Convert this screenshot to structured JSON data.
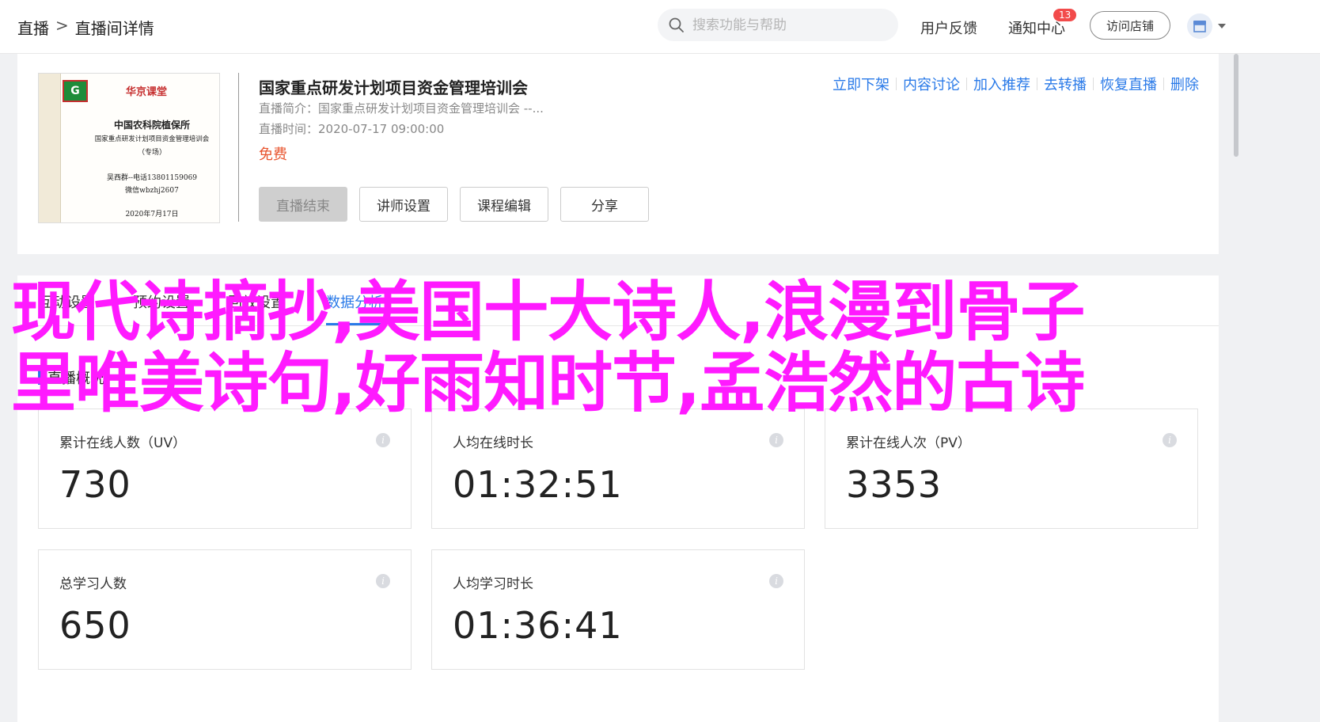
{
  "header": {
    "breadcrumb": [
      "直播",
      "直播间详情"
    ],
    "breadcrumb_sep": ">",
    "search_placeholder": "搜索功能与帮助",
    "feedback": "用户反馈",
    "notifications": "通知中心",
    "notification_count": "13",
    "visit_store": "访问店铺"
  },
  "course": {
    "title": "国家重点研发计划项目资金管理培训会",
    "intro": "直播简介：国家重点研发计划项目资金管理培训会 --...",
    "time": "直播时间：2020-07-17 09:00:00",
    "price": "免费",
    "buttons": {
      "end": "直播结束",
      "lecturer": "讲师设置",
      "edit": "课程编辑",
      "share": "分享"
    },
    "actions": [
      "立即下架",
      "内容讨论",
      "加入推荐",
      "去转播",
      "恢复直播",
      "删除"
    ],
    "poster": {
      "logo": "G",
      "brand": "华京课堂",
      "org": "中国农科院植保所",
      "title": "国家重点研发计划项目资金管理培训会",
      "subtitle": "（专场）",
      "contact1": "吴西群--电话13801159069",
      "contact2": "微信wbzhj2607",
      "date": "2020年7月17日"
    }
  },
  "tabs": [
    "互动设置",
    "预约设置",
    "回放设置",
    "数据分析"
  ],
  "section_title": "直播概况",
  "stats": [
    {
      "label": "累计在线人数（UV）",
      "value": "730"
    },
    {
      "label": "人均在线时长",
      "value": "01:32:51"
    },
    {
      "label": "累计在线人次（PV）",
      "value": "3353"
    },
    {
      "label": "总学习人数",
      "value": "650"
    },
    {
      "label": "人均学习时长",
      "value": "01:36:41"
    }
  ],
  "overlay": {
    "line1": "现代诗摘抄,美国十大诗人,浪漫到骨子",
    "line2": "里唯美诗句,好雨知时节,孟浩然的古诗"
  },
  "colors": {
    "accent": "#2a7ae8",
    "overlay": "#ff1aff",
    "price": "#e8542e",
    "badge": "#f24b4b"
  }
}
